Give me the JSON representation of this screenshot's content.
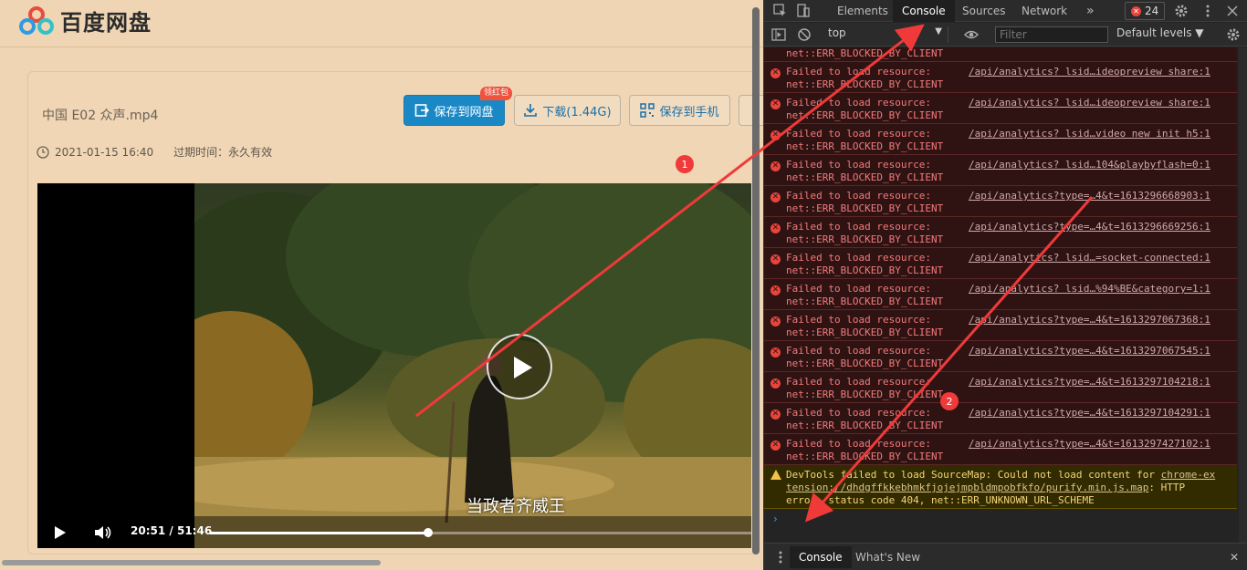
{
  "page": {
    "brand": "百度网盘",
    "file": {
      "name": "中国 E02 众声.mp4",
      "date": "2021-01-15 16:40",
      "expiry": "过期时间：永久有效"
    },
    "buttons": {
      "save": "保存到网盘",
      "save_badge": "领红包",
      "download": "下载(1.44G)",
      "phone": "保存到手机"
    },
    "player": {
      "subtitle": "当政者齐威王",
      "current": "20:51",
      "separator": "/",
      "duration": "51:46",
      "progress": 0.403
    }
  },
  "devtools": {
    "tabs": [
      "Elements",
      "Console",
      "Sources",
      "Network"
    ],
    "more": "»",
    "active_tab": "Console",
    "error_count": "24",
    "context": "top",
    "filter_placeholder": "Filter",
    "levels": "Default levels ▼",
    "partial_row": "net::ERR_BLOCKED_BY_CLIENT",
    "errors": [
      {
        "msg": "Failed to load resource:",
        "reason": "net::ERR_BLOCKED_BY_CLIENT",
        "src": "/api/analytics? lsid…ideopreview share:1"
      },
      {
        "msg": "Failed to load resource:",
        "reason": "net::ERR_BLOCKED_BY_CLIENT",
        "src": "/api/analytics? lsid…ideopreview share:1"
      },
      {
        "msg": "Failed to load resource:",
        "reason": "net::ERR_BLOCKED_BY_CLIENT",
        "src": "/api/analytics? lsid…video new init h5:1"
      },
      {
        "msg": "Failed to load resource:",
        "reason": "net::ERR_BLOCKED_BY_CLIENT",
        "src": "/api/analytics? lsid…104&playbyflash=0:1"
      },
      {
        "msg": "Failed to load resource:",
        "reason": "net::ERR_BLOCKED_BY_CLIENT",
        "src": "/api/analytics?type=…4&t=1613296668903:1"
      },
      {
        "msg": "Failed to load resource:",
        "reason": "net::ERR_BLOCKED_BY_CLIENT",
        "src": "/api/analytics?type=…4&t=1613296669256:1"
      },
      {
        "msg": "Failed to load resource:",
        "reason": "net::ERR_BLOCKED_BY_CLIENT",
        "src": "/api/analytics? lsid…=socket-connected:1"
      },
      {
        "msg": "Failed to load resource:",
        "reason": "net::ERR_BLOCKED_BY_CLIENT",
        "src": "/api/analytics? lsid…%94%BE&category=1:1"
      },
      {
        "msg": "Failed to load resource:",
        "reason": "net::ERR_BLOCKED_BY_CLIENT",
        "src": "/api/analytics?type=…4&t=1613297067368:1"
      },
      {
        "msg": "Failed to load resource:",
        "reason": "net::ERR_BLOCKED_BY_CLIENT",
        "src": "/api/analytics?type=…4&t=1613297067545:1"
      },
      {
        "msg": "Failed to load resource:",
        "reason": "net::ERR_BLOCKED_BY_CLIENT",
        "src": "/api/analytics?type=…4&t=1613297104218:1"
      },
      {
        "msg": "Failed to load resource:",
        "reason": "net::ERR_BLOCKED_BY_CLIENT",
        "src": "/api/analytics?type=…4&t=1613297104291:1"
      },
      {
        "msg": "Failed to load resource:",
        "reason": "net::ERR_BLOCKED_BY_CLIENT",
        "src": "/api/analytics?type=…4&t=1613297427102:1"
      }
    ],
    "warning": {
      "line1_text": "DevTools failed to load SourceMap: Could not load content for ",
      "line1_link": "chrome-ex",
      "line2_link": "tension://dhdgffkkebhmkfjojejmpbldmpobfkfo/purify.min.js.map",
      "line2_text": ": HTTP",
      "line3_text": "error: status code 404, net::ERR_UNKNOWN_URL_SCHEME"
    },
    "prompt": "›",
    "drawer_tabs": [
      "Console",
      "What's New"
    ],
    "close": "✕"
  },
  "annotations": [
    "1",
    "2"
  ],
  "colors": {
    "accent": "#1b88c6",
    "annotation": "#f03a3a",
    "error_bg": "#2f1313",
    "warning_bg": "#332b00"
  }
}
